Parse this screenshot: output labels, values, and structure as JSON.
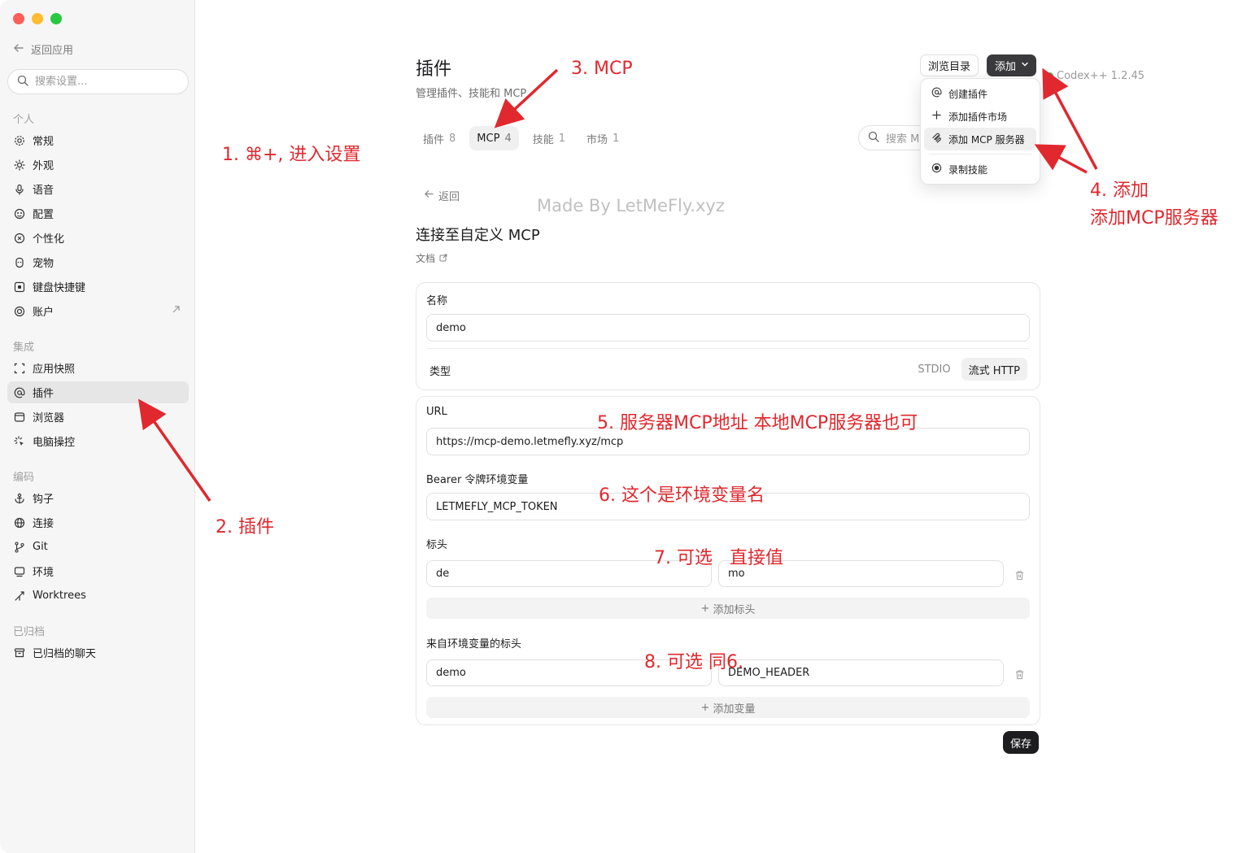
{
  "sidebar": {
    "back_label": "返回应用",
    "search_placeholder": "搜索设置...",
    "groups": [
      {
        "label": "个人",
        "items": [
          {
            "label": "常规",
            "icon": "gear-icon"
          },
          {
            "label": "外观",
            "icon": "sun-icon"
          },
          {
            "label": "语音",
            "icon": "microphone-icon"
          },
          {
            "label": "配置",
            "icon": "config-icon"
          },
          {
            "label": "个性化",
            "icon": "personalize-icon"
          },
          {
            "label": "宠物",
            "icon": "pet-icon"
          },
          {
            "label": "键盘快捷键",
            "icon": "keyboard-icon"
          },
          {
            "label": "账户",
            "icon": "account-icon"
          }
        ]
      },
      {
        "label": "集成",
        "items": [
          {
            "label": "应用快照",
            "icon": "snapshot-icon"
          },
          {
            "label": "插件",
            "icon": "at-icon"
          },
          {
            "label": "浏览器",
            "icon": "browser-icon"
          },
          {
            "label": "电脑操控",
            "icon": "pointer-icon"
          }
        ]
      },
      {
        "label": "编码",
        "items": [
          {
            "label": "钩子",
            "icon": "anchor-icon"
          },
          {
            "label": "连接",
            "icon": "globe-icon"
          },
          {
            "label": "Git",
            "icon": "git-branch-icon"
          },
          {
            "label": "环境",
            "icon": "monitor-icon"
          },
          {
            "label": "Worktrees",
            "icon": "worktree-icon"
          }
        ]
      },
      {
        "label": "已归档",
        "items": [
          {
            "label": "已归档的聊天",
            "icon": "archive-icon"
          }
        ]
      }
    ]
  },
  "header": {
    "title": "插件",
    "subtitle": "管理插件、技能和 MCP",
    "browse_label": "浏览目录",
    "add_label": "添加",
    "version": "Codex++ 1.2.45"
  },
  "tabs": [
    {
      "label": "插件",
      "count": "8"
    },
    {
      "label": "MCP",
      "count": "4"
    },
    {
      "label": "技能",
      "count": "1"
    },
    {
      "label": "市场",
      "count": "1"
    }
  ],
  "search_mcp_placeholder": "搜索 MCP",
  "dropdown": [
    {
      "label": "创建插件",
      "icon": "at-icon"
    },
    {
      "label": "添加插件市场",
      "icon": "plus-icon"
    },
    {
      "label": "添加 MCP 服务器",
      "icon": "mcp-icon"
    },
    {
      "label": "录制技能",
      "icon": "record-icon"
    }
  ],
  "form": {
    "back_label": "返回",
    "title": "连接至自定义 MCP",
    "docs_label": "文档",
    "name_label": "名称",
    "name_value": "demo",
    "type_label": "类型",
    "type_options": [
      "STDIO",
      "流式 HTTP"
    ],
    "type_selected": "流式 HTTP",
    "url_label": "URL",
    "url_value": "https://mcp-demo.letmefly.xyz/mcp",
    "bearer_label": "Bearer 令牌环境变量",
    "bearer_value": "LETMEFLY_MCP_TOKEN",
    "headers_label": "标头",
    "header_key": "de",
    "header_value": "mo",
    "add_header_label": "添加标头",
    "env_headers_label": "来自环境变量的标头",
    "env_header_key": "demo",
    "env_header_value": "DEMO_HEADER",
    "add_var_label": "添加变量",
    "save_label": "保存"
  },
  "watermark": "Made By LetMeFly.xyz",
  "annotations": {
    "a1": "1. ⌘+, 进入设置",
    "a2": "2. 插件",
    "a3": "3. MCP",
    "a4_line1": "4. 添加",
    "a4_line2": "添加MCP服务器",
    "a5": "5. 服务器MCP地址 本地MCP服务器也可",
    "a6": "6. 这个是环境变量名",
    "a7": "7. 可选   直接值",
    "a8": "8. 可选 同6."
  },
  "colors": {
    "annotation": "#e0282e",
    "accent_dark": "#3a3a3c",
    "status_green": "#2bb673"
  }
}
